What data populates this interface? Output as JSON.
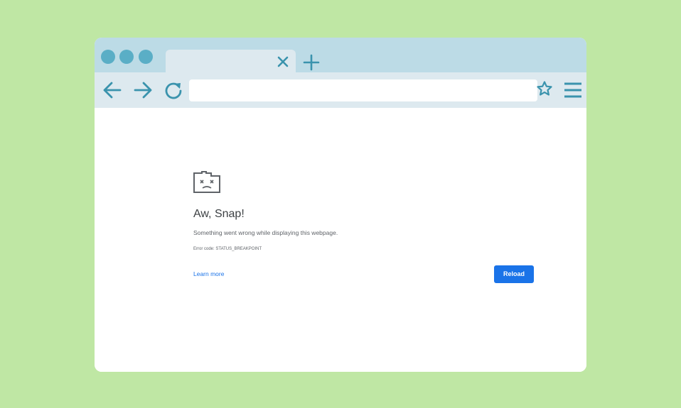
{
  "colors": {
    "background": "#bfe7a4",
    "chrome": "#bcdbe6",
    "toolbar": "#dde9ef",
    "icon": "#3a93ad",
    "dot": "#5aaec6",
    "accent": "#1a73e8"
  },
  "tabs": [
    {
      "title": "",
      "icon": "close-icon",
      "active": true
    }
  ],
  "toolbar": {
    "icons": [
      "back-arrow-icon",
      "forward-arrow-icon",
      "reload-icon",
      "star-icon",
      "hamburger-menu-icon"
    ],
    "address_value": ""
  },
  "error_page": {
    "icon": "sad-folder-icon",
    "title": "Aw, Snap!",
    "message": "Something went wrong while displaying this webpage.",
    "error_code": "Error code: STATUS_BREAKPOINT",
    "learn_more": "Learn more",
    "reload_label": "Reload"
  }
}
